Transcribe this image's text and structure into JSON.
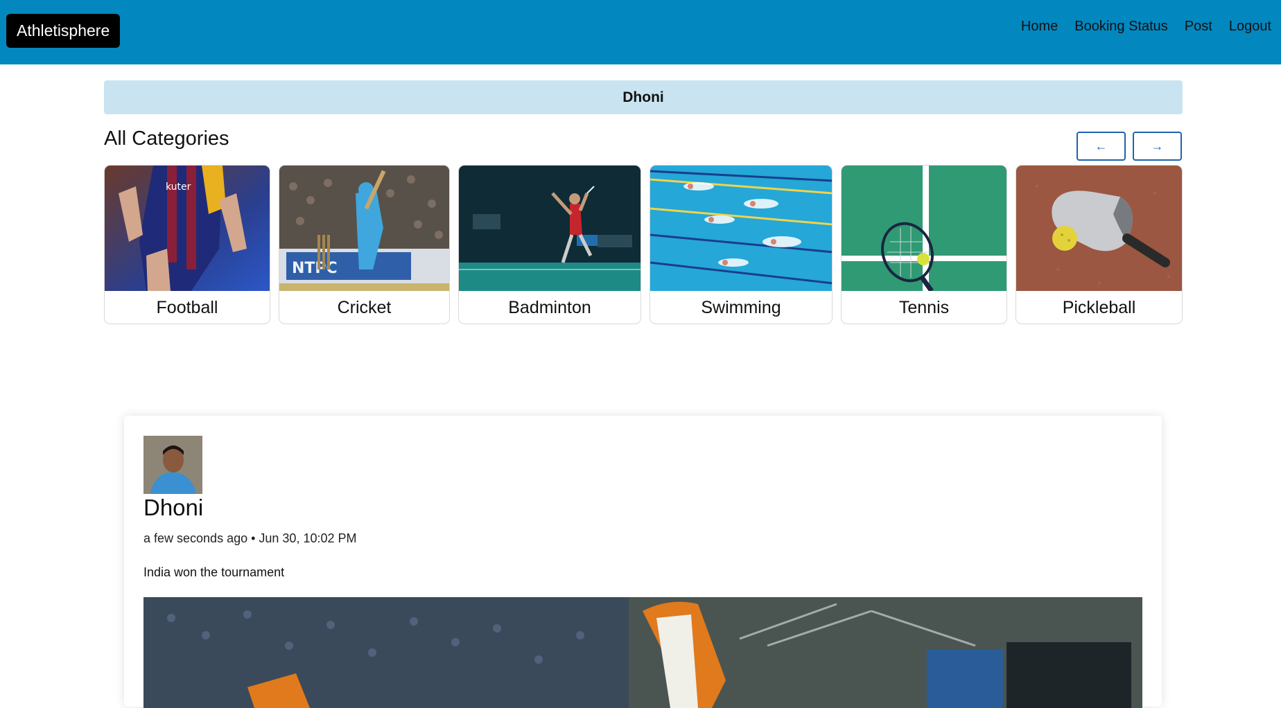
{
  "navbar": {
    "brand": "Athletisphere",
    "links": [
      "Home",
      "Booking Status",
      "Post",
      "Logout"
    ]
  },
  "user_banner": "Dhoni",
  "categories_section": {
    "title": "All Categories",
    "prev_label": "←",
    "next_label": "→",
    "items": [
      {
        "label": "Football",
        "icon": "football-photo"
      },
      {
        "label": "Cricket",
        "icon": "cricket-photo"
      },
      {
        "label": "Badminton",
        "icon": "badminton-photo"
      },
      {
        "label": "Swimming",
        "icon": "swimming-photo"
      },
      {
        "label": "Tennis",
        "icon": "tennis-photo"
      },
      {
        "label": "Pickleball",
        "icon": "pickleball-photo"
      }
    ]
  },
  "post": {
    "author": "Dhoni",
    "meta": "a few seconds ago • Jun 30, 10:02 PM",
    "text": "India won the tournament"
  },
  "colors": {
    "navbar": "#0387bf",
    "banner": "#c9e4f0",
    "accent": "#1f62b0"
  }
}
